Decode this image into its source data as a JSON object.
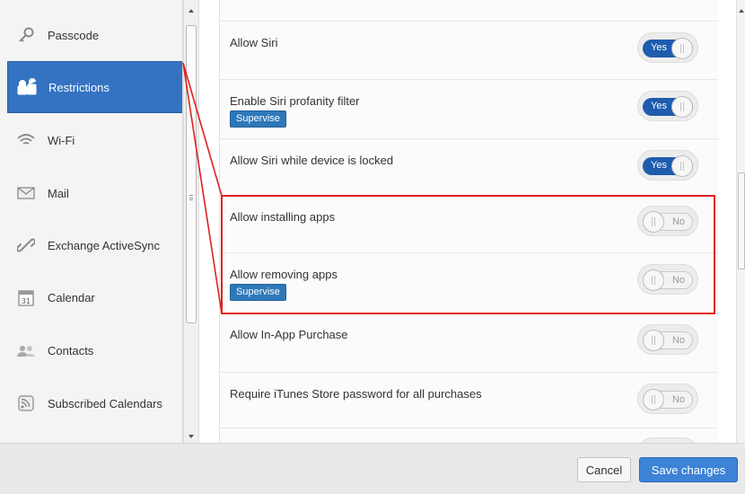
{
  "sidebar": {
    "items": [
      {
        "label": "Passcode",
        "icon": "key-icon"
      },
      {
        "label": "Restrictions",
        "icon": "lock-icon",
        "active": true
      },
      {
        "label": "Wi-Fi",
        "icon": "wifi-icon"
      },
      {
        "label": "Mail",
        "icon": "mail-icon"
      },
      {
        "label": "Exchange ActiveSync",
        "icon": "exchange-icon"
      },
      {
        "label": "Calendar",
        "icon": "calendar-icon",
        "calendar_day": "31"
      },
      {
        "label": "Contacts",
        "icon": "contacts-icon"
      },
      {
        "label": "Subscribed Calendars",
        "icon": "rss-icon"
      }
    ]
  },
  "settings": {
    "rows": [
      {
        "label": "Allow Siri",
        "state": "on",
        "toggle_text": "Yes"
      },
      {
        "label": "Enable Siri profanity filter",
        "badge": "Supervise",
        "state": "on",
        "toggle_text": "Yes"
      },
      {
        "label": "Allow Siri while device is locked",
        "state": "on",
        "toggle_text": "Yes"
      },
      {
        "label": "Allow installing apps",
        "state": "off",
        "toggle_text": "No"
      },
      {
        "label": "Allow removing apps",
        "badge": "Supervise",
        "state": "off",
        "toggle_text": "No"
      },
      {
        "label": "Allow In-App Purchase",
        "state": "off",
        "toggle_text": "No"
      },
      {
        "label": "Require iTunes Store password for all purchases",
        "state": "off",
        "toggle_text": "No"
      }
    ]
  },
  "footer": {
    "cancel_label": "Cancel",
    "save_label": "Save changes"
  },
  "colors": {
    "accent": "#3473c2",
    "toggle_on": "#1e5cae",
    "badge": "#2f78b8",
    "annotation": "#e02020",
    "save_button": "#3d83d6"
  }
}
